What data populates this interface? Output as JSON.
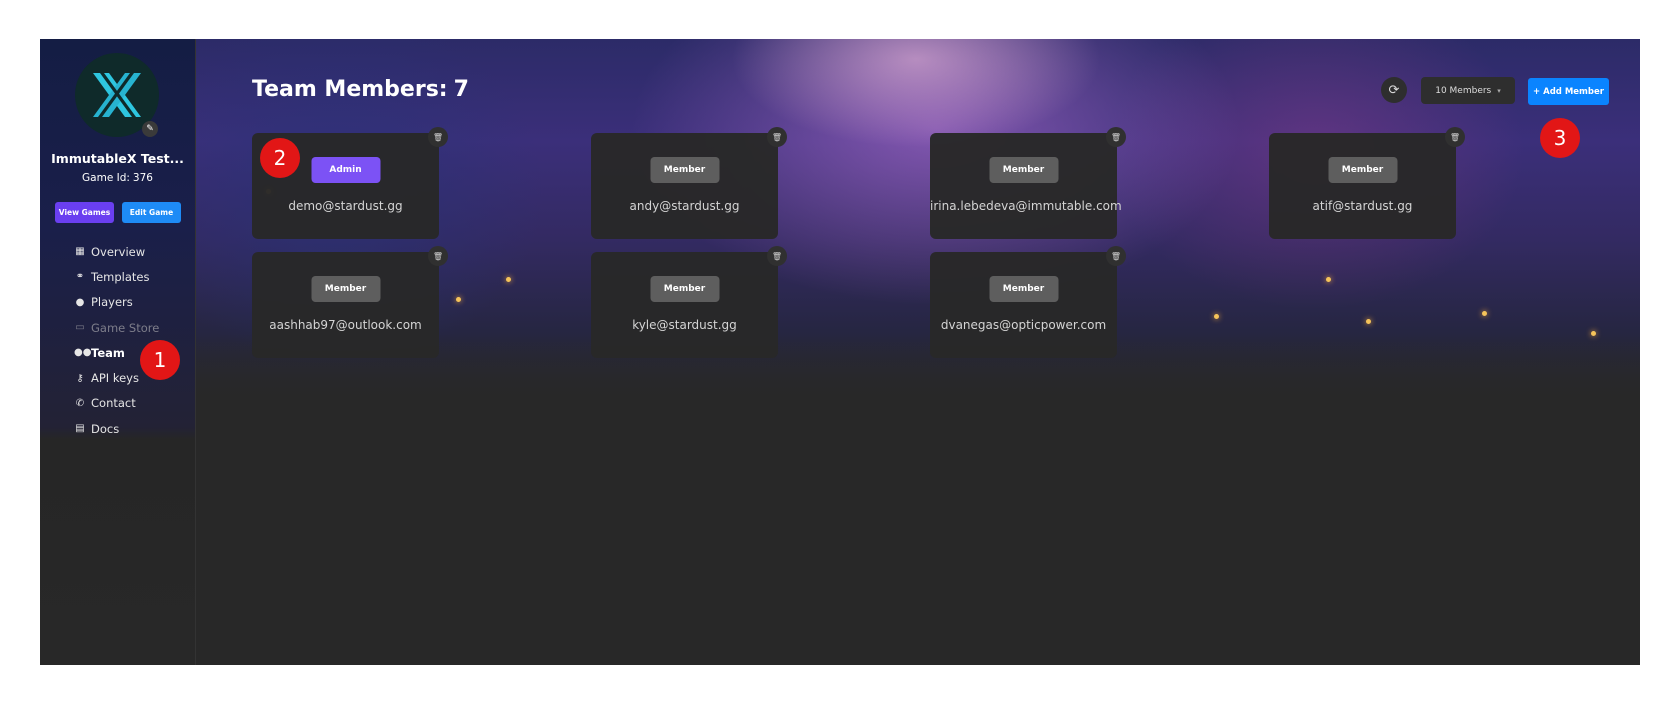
{
  "sidebar": {
    "game_name": "ImmutableX Test...",
    "game_id_label": "Game Id:",
    "game_id_value": "376",
    "view_games_label": "View Games",
    "edit_game_label": "Edit Game",
    "nav": [
      {
        "label": "Overview",
        "icon": "grid-icon",
        "glyph": "▦",
        "state": "normal"
      },
      {
        "label": "Templates",
        "icon": "shapes-icon",
        "glyph": "⚭",
        "state": "normal"
      },
      {
        "label": "Players",
        "icon": "user-icon",
        "glyph": "●",
        "state": "normal"
      },
      {
        "label": "Game Store",
        "icon": "store-icon",
        "glyph": "▭",
        "state": "disabled"
      },
      {
        "label": "Team",
        "icon": "users-icon",
        "glyph": "●●",
        "state": "active"
      },
      {
        "label": "API keys",
        "icon": "key-icon",
        "glyph": "⚷",
        "state": "normal"
      },
      {
        "label": "Contact",
        "icon": "phone-icon",
        "glyph": "✆",
        "state": "normal"
      },
      {
        "label": "Docs",
        "icon": "document-icon",
        "glyph": "▤",
        "state": "normal"
      }
    ]
  },
  "header": {
    "title": "Team Members:",
    "count": "7",
    "members_select": "10 Members",
    "add_member_label": "+ Add Member"
  },
  "members": [
    {
      "role": "Admin",
      "email": "demo@stardust.gg"
    },
    {
      "role": "Member",
      "email": "andy@stardust.gg"
    },
    {
      "role": "Member",
      "email": "irina.lebedeva@immutable.com"
    },
    {
      "role": "Member",
      "email": "atif@stardust.gg"
    },
    {
      "role": "Member",
      "email": "aashhab97@outlook.com"
    },
    {
      "role": "Member",
      "email": "kyle@stardust.gg"
    },
    {
      "role": "Member",
      "email": "dvanegas@opticpower.com"
    }
  ],
  "markers": [
    "1",
    "2",
    "3"
  ],
  "colors": {
    "admin_badge": "#7c52f5",
    "member_badge": "#5e5e5e",
    "add_button": "#0a84ff",
    "view_games_button": "#6a3ff0",
    "edit_game_button": "#1e8bf6",
    "marker": "#e21616"
  }
}
